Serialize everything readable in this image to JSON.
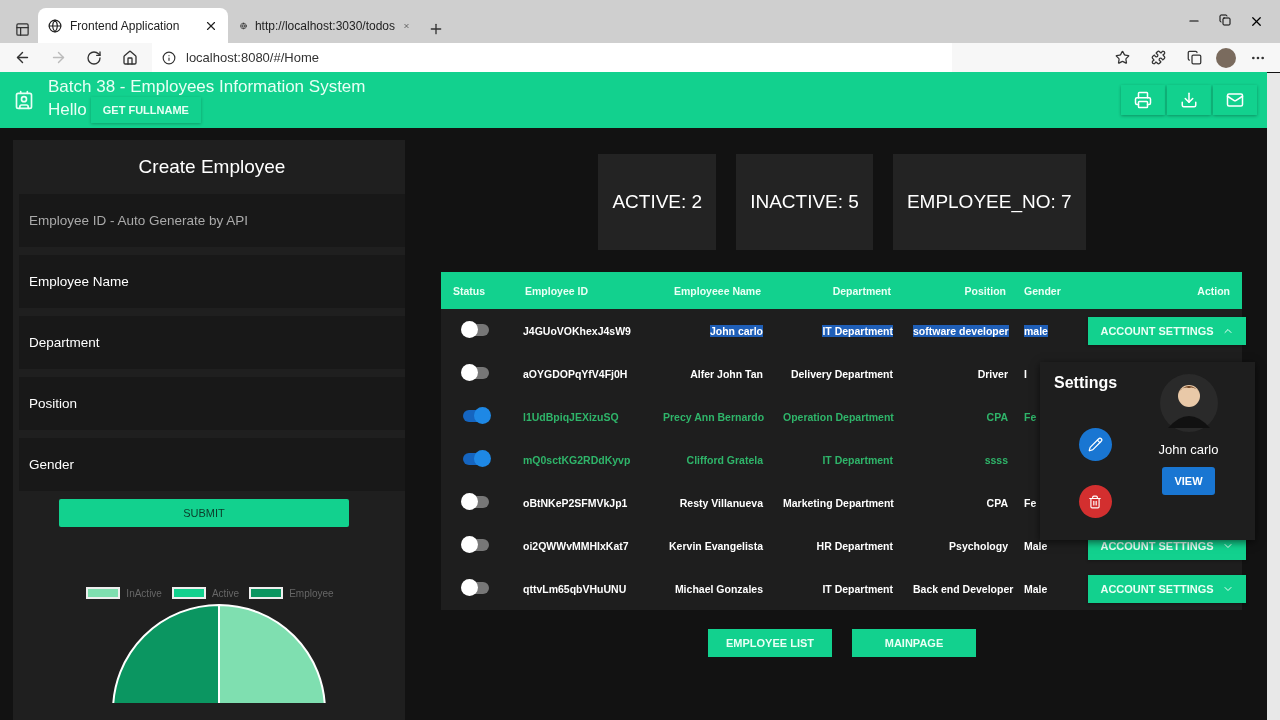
{
  "browser": {
    "tabs": [
      {
        "title": "Frontend Application",
        "selected": true
      },
      {
        "title": "http://localhost:3030/todos",
        "selected": false
      }
    ],
    "url": "localhost:8080/#/Home"
  },
  "header": {
    "title": "Batch 38 - Employees Information System",
    "greeting": "Hello",
    "button": "GET FULLNAME"
  },
  "form": {
    "title": "Create Employee",
    "fields": [
      {
        "kind": "placeholder",
        "text": "Employee ID - Auto Generate by API"
      },
      {
        "kind": "label",
        "text": "Employee Name"
      },
      {
        "kind": "label",
        "text": "Department"
      },
      {
        "kind": "label",
        "text": "Position"
      },
      {
        "kind": "label",
        "text": "Gender"
      }
    ],
    "submit": "SUBMIT",
    "legend": [
      {
        "label": "InActive",
        "color": "#7fdfb0"
      },
      {
        "label": "Active",
        "color": "#12d18e"
      },
      {
        "label": "Employee",
        "color": "#0b9661"
      }
    ]
  },
  "stats": [
    "ACTIVE: 2",
    "INACTIVE: 5",
    "EMPLOYEE_NO: 7"
  ],
  "table": {
    "columns": [
      "Status",
      "Employee ID",
      "Employeee Name",
      "Department",
      "Position",
      "Gender",
      "Action"
    ],
    "rows": [
      {
        "active": false,
        "highlighted": true,
        "id": "J4GUoVOKhexJ4sW9",
        "name": "John carlo",
        "department": "IT Department",
        "position": "software developer",
        "gender": "male",
        "action": {
          "label": "ACCOUNT SETTINGS",
          "expanded": true
        }
      },
      {
        "active": false,
        "highlighted": false,
        "id": "aOYGDOPqYfV4Fj0H",
        "name": "Alfer John Tan",
        "department": "Delivery Department",
        "position": "Driver",
        "gender": "I"
      },
      {
        "active": true,
        "highlighted": false,
        "id": "l1UdBpiqJEXizuSQ",
        "name": "Precy Ann Bernardo",
        "department": "Operation Department",
        "position": "CPA",
        "gender": "Fe"
      },
      {
        "active": true,
        "highlighted": false,
        "id": "mQ0sctKG2RDdKyvp",
        "name": "Clifford Gratela",
        "department": "IT Department",
        "position": "ssss"
      },
      {
        "active": false,
        "highlighted": false,
        "id": "oBtNKeP2SFMVkJp1",
        "name": "Resty Villanueva",
        "department": "Marketing Department",
        "position": "CPA",
        "gender": "Fe"
      },
      {
        "active": false,
        "highlighted": false,
        "id": "oi2QWWvMMHIxKat7",
        "name": "Kervin Evangelista",
        "department": "HR Department",
        "position": "Psychology",
        "gender": "Male",
        "action": {
          "label": "ACCOUNT SETTINGS",
          "expanded": false
        }
      },
      {
        "active": false,
        "highlighted": false,
        "id": "qttvLm65qbVHuUNU",
        "name": "Michael Gonzales",
        "department": "IT Department",
        "position": "Back end Developer",
        "gender": "Male",
        "action": {
          "label": "ACCOUNT SETTINGS",
          "expanded": false
        }
      }
    ]
  },
  "popup": {
    "title": "Settings",
    "name": "John carlo",
    "button": "VIEW"
  },
  "footer_buttons": [
    "EMPLOYEE LIST",
    "MAINPAGE"
  ]
}
